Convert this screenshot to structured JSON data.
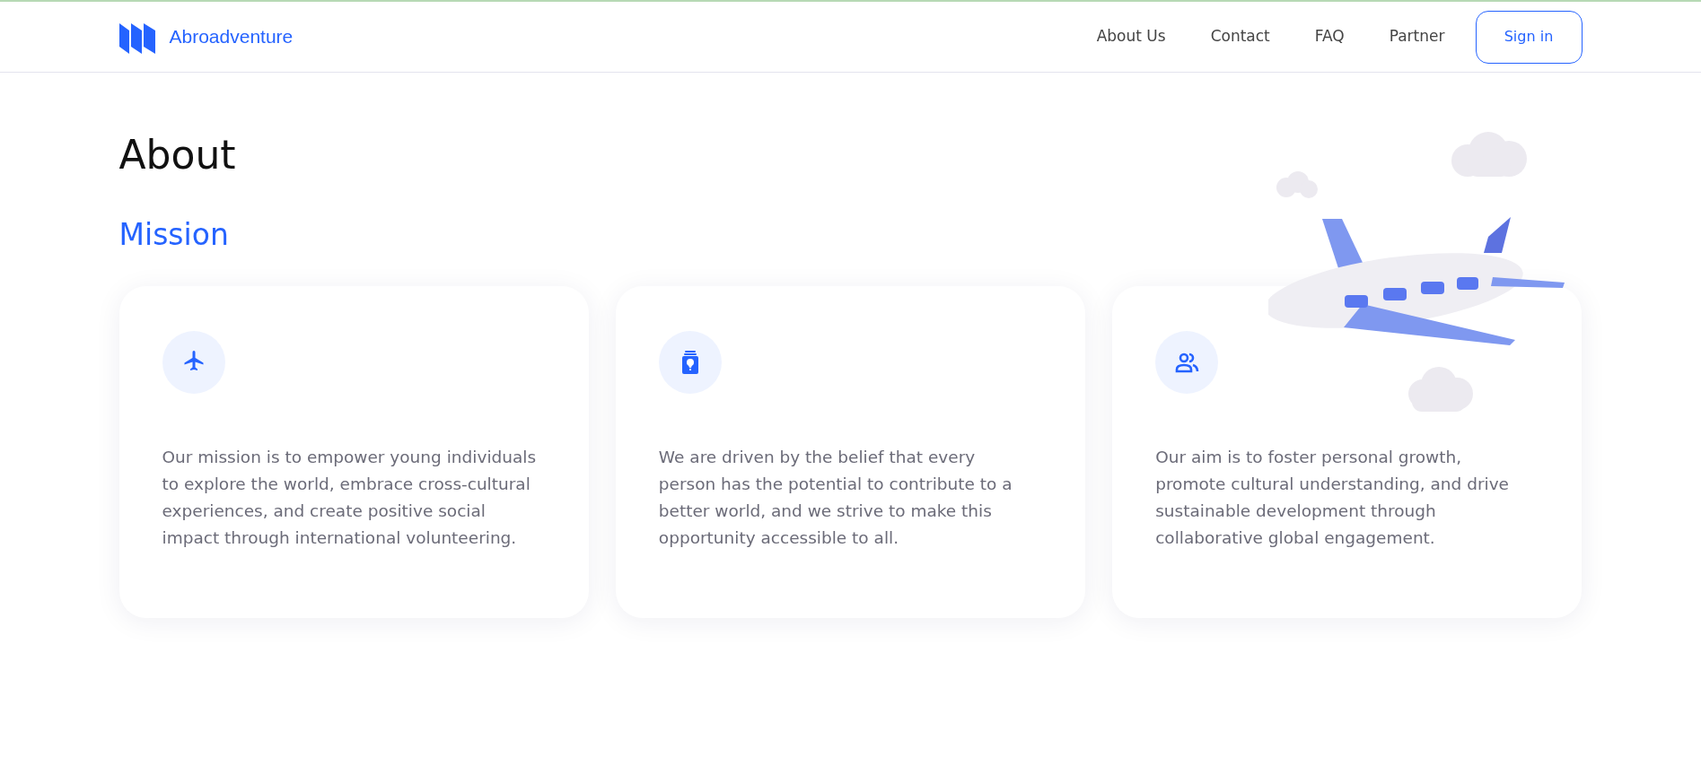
{
  "brand": {
    "name": "Abroadventure"
  },
  "nav": [
    {
      "label": "About Us"
    },
    {
      "label": "Contact"
    },
    {
      "label": "FAQ"
    },
    {
      "label": "Partner"
    }
  ],
  "sign_in": {
    "label": "Sign in"
  },
  "page_title": "About",
  "section_title": "Mission",
  "cards": [
    {
      "text": "Our mission is to empower young individuals to explore the world, embrace cross-cultural experiences, and create positive social impact through international volunteering."
    },
    {
      "text": "We are driven by the belief that every person has the potential to contribute to a better world, and we strive to make this opportunity accessible to all."
    },
    {
      "text": "Our aim is to foster personal growth, promote cultural understanding, and drive sustainable development through collaborative global engagement."
    }
  ]
}
